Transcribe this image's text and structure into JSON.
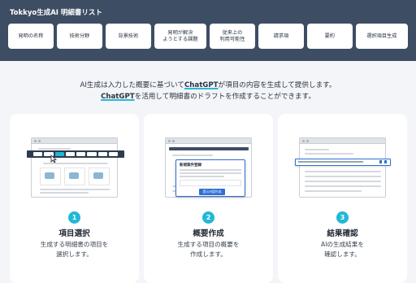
{
  "header": {
    "title": "Tokkyo生成AI 明細書リスト",
    "tabs": [
      {
        "label": "発明の名称"
      },
      {
        "label": "技術分野"
      },
      {
        "label": "背景技術"
      },
      {
        "label": "発明が解決\nようとする課題"
      },
      {
        "label": "従来上の\n利用可能性"
      },
      {
        "label": "請求項"
      },
      {
        "label": "要約"
      },
      {
        "label": "選択項目生成"
      }
    ]
  },
  "intro": {
    "line1_pre": "AI生成は入力した概要に基づいて",
    "line1_hl": "ChatGPT",
    "line1_post": "が項目の内容を生成して提供します。",
    "line2_hl": "ChatGPT",
    "line2_post": "を活用して明細書のドラフトを作成することができます。"
  },
  "steps": [
    {
      "num": "1",
      "title": "項目選択",
      "desc": "生成する明細書の項目を\n選択します。"
    },
    {
      "num": "2",
      "title": "概要作成",
      "desc": "生成する項目の概要を\n作成します。",
      "dialog_title": "新規案件登録",
      "dialog_button": "提示内容作成"
    },
    {
      "num": "3",
      "title": "結果確認",
      "desc": "AIの生成結果を\n確認します。"
    }
  ]
}
